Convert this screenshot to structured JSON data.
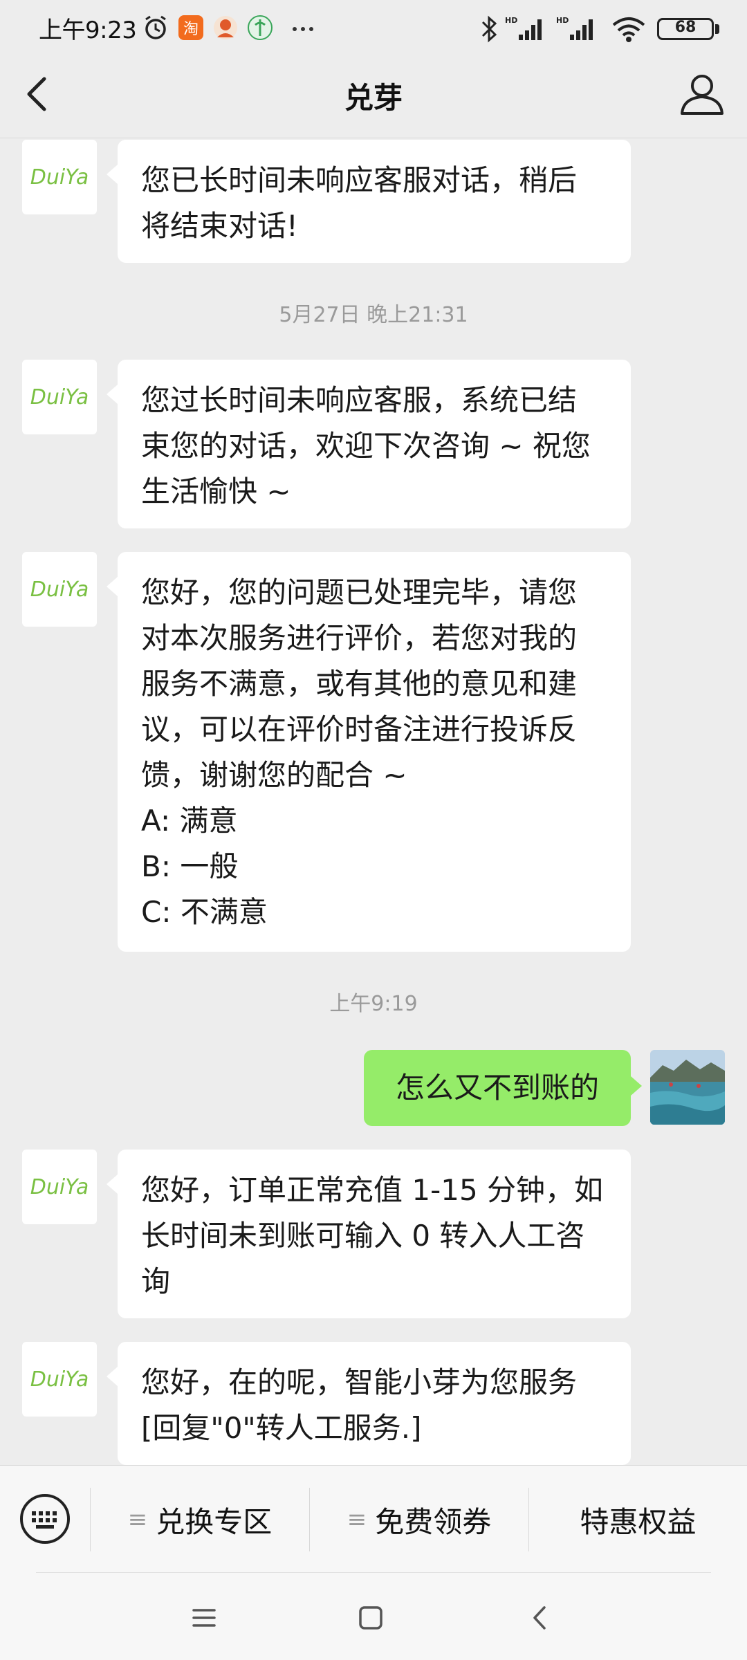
{
  "status_bar": {
    "time": "上午9:23",
    "battery": "68",
    "network_badges": [
      "HD",
      "HD"
    ]
  },
  "header": {
    "title": "兑芽"
  },
  "bot": {
    "avatar_text": "DuiYa",
    "brand_color": "#7ac043"
  },
  "messages": [
    {
      "lines": [
        "您已长时间未响应客服对话，稍后",
        "将结束对话!"
      ]
    },
    {
      "timestamp": "5月27日 晚上21:31"
    },
    {
      "lines": [
        "您过长时间未响应客服，系统已结",
        "束您的对话，欢迎下次咨询 ~ 祝您",
        "生活愉快 ~"
      ]
    },
    {
      "lines": [
        "您好，您的问题已处理完毕，请您",
        "对本次服务进行评价，若您对我的",
        "服务不满意，或有其他的意见和建",
        "议，可以在评价时备注进行投诉反",
        "馈，谢谢您的配合 ~",
        "A: 满意",
        "B: 一般",
        "C: 不满意"
      ]
    },
    {
      "timestamp": "上午9:19"
    },
    {
      "user_text": "怎么又不到账的"
    },
    {
      "lines": [
        "您好，订单正常充值 1-15 分钟，如",
        "长时间未到账可输入 0 转入人工咨",
        "询"
      ]
    },
    {
      "lines": [
        "您好，在的呢，智能小芽为您服务",
        "[回复\"0\"转人工服务.]"
      ]
    }
  ],
  "bottom_menu": {
    "items": [
      {
        "label": "兑换专区",
        "has_submenu": true
      },
      {
        "label": "免费领券",
        "has_submenu": true
      },
      {
        "label": "特惠权益",
        "has_submenu": false
      }
    ]
  },
  "colors": {
    "background": "#ededed",
    "user_bubble": "#95ec69",
    "bot_bubble": "#ffffff"
  }
}
